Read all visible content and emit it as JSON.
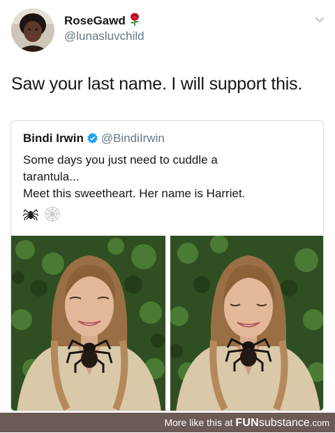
{
  "tweet": {
    "display_name": "RoseGawd",
    "handle": "@lunasluvchild",
    "text": "Saw your last name. I will support this.",
    "icons": {
      "name_emoji": "rose-icon",
      "menu": "chevron-down-icon"
    }
  },
  "quoted_tweet": {
    "display_name": "Bindi Irwin",
    "handle": "@BindiIrwin",
    "text_line1": "Some days you just need to cuddle a",
    "text_line2": "tarantula...",
    "text_line3": "Meet this sweetheart. Her name is Harriet.",
    "emojis": [
      "spider-icon",
      "spider-web-icon"
    ],
    "verified_icon": "verified-badge-icon",
    "photos": [
      "woman-with-tarantula-photo-1",
      "woman-with-tarantula-photo-2"
    ]
  },
  "footer": {
    "prefix": "More like this at",
    "brand_fun": "FUN",
    "brand_rest": "substance",
    "brand_domain": ".com"
  },
  "colors": {
    "text_primary": "#14171a",
    "text_secondary": "#657786",
    "verified_blue": "#1da1f2",
    "footer_bg": "#6c5a55",
    "border": "#d7dde2"
  }
}
